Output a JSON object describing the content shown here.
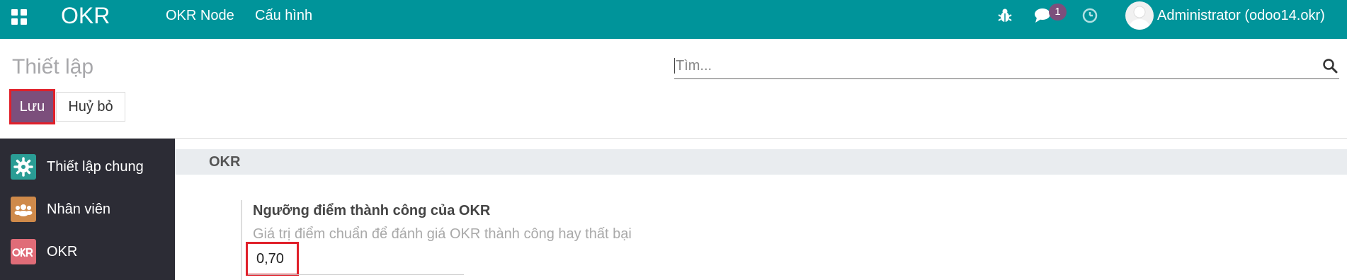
{
  "navbar": {
    "brand": "OKR",
    "menu": [
      "OKR Node",
      "Cấu hình"
    ],
    "icons": [
      "apps-icon",
      "bug-icon",
      "chat-icon",
      "clock-icon"
    ],
    "messages_badge": "1",
    "user_name": "Administrator (odoo14.okr)",
    "bg_color": "#00949a"
  },
  "control_panel": {
    "title": "Thiết lập",
    "search_placeholder": "Tìm...",
    "save_label": "Lưu",
    "cancel_label": "Huỷ bỏ"
  },
  "sidebar": {
    "items": [
      {
        "label": "Thiết lập chung",
        "icon": "gear-icon"
      },
      {
        "label": "Nhân viên",
        "icon": "users-icon"
      },
      {
        "label": "OKR",
        "icon": "okr-logo-icon"
      }
    ]
  },
  "settings": {
    "section_title": "OKR",
    "field_label": "Ngưỡng điểm thành công của OKR",
    "field_help": "Giá trị điểm chuẩn để đánh giá OKR thành công hay thất bại",
    "field_value": "0,70"
  },
  "colors": {
    "primary": "#7c4f7c",
    "highlight": "#e0202a",
    "sidebar_bg": "#2c2c35"
  }
}
